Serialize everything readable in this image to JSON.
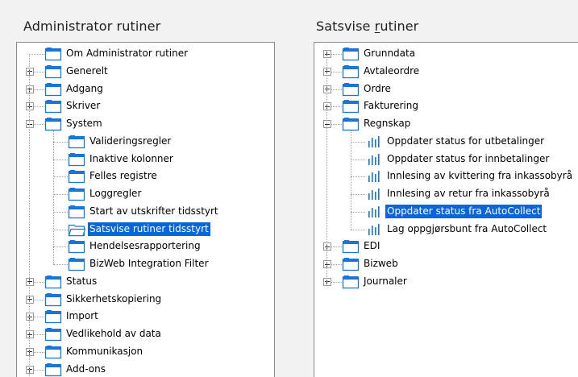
{
  "left_panel": {
    "title": "Administrator rutiner",
    "items": [
      {
        "label": "Om Administrator rutiner",
        "level": 0,
        "expander": "none"
      },
      {
        "label": "Generelt",
        "level": 0,
        "expander": "plus"
      },
      {
        "label": "Adgang",
        "level": 0,
        "expander": "plus"
      },
      {
        "label": "Skriver",
        "level": 0,
        "expander": "plus"
      },
      {
        "label": "System",
        "level": 0,
        "expander": "minus"
      },
      {
        "label": "Valideringsregler",
        "level": 1,
        "expander": "none"
      },
      {
        "label": "Inaktive kolonner",
        "level": 1,
        "expander": "none"
      },
      {
        "label": "Felles registre",
        "level": 1,
        "expander": "none"
      },
      {
        "label": "Loggregler",
        "level": 1,
        "expander": "none"
      },
      {
        "label": "Start av utskrifter tidsstyrt",
        "level": 1,
        "expander": "none"
      },
      {
        "label": "Satsvise rutiner tidsstyrt",
        "level": 1,
        "expander": "none",
        "selected": true,
        "open": true
      },
      {
        "label": "Hendelsesrapportering",
        "level": 1,
        "expander": "none"
      },
      {
        "label": "BizWeb Integration Filter",
        "level": 1,
        "expander": "none"
      },
      {
        "label": "Status",
        "level": 0,
        "expander": "plus"
      },
      {
        "label": "Sikkerhetskopiering",
        "level": 0,
        "expander": "plus"
      },
      {
        "label": "Import",
        "level": 0,
        "expander": "plus"
      },
      {
        "label": "Vedlikehold av data",
        "level": 0,
        "expander": "plus"
      },
      {
        "label": "Kommunikasjon",
        "level": 0,
        "expander": "plus"
      },
      {
        "label": "Add-ons",
        "level": 0,
        "expander": "plus"
      }
    ]
  },
  "right_panel": {
    "title_prefix": "Satsvise ",
    "title_accel": "r",
    "title_rest": "utiner",
    "items": [
      {
        "label": "Grunndata",
        "level": 0,
        "expander": "plus"
      },
      {
        "label": "Avtaleordre",
        "level": 0,
        "expander": "plus"
      },
      {
        "label": "Ordre",
        "level": 0,
        "expander": "plus"
      },
      {
        "label": "Fakturering",
        "level": 0,
        "expander": "plus"
      },
      {
        "label": "Regnskap",
        "level": 0,
        "expander": "minus"
      },
      {
        "label": "Oppdater status for utbetalinger",
        "level": 1,
        "kind": "chart"
      },
      {
        "label": "Oppdater status for innbetalinger",
        "level": 1,
        "kind": "chart"
      },
      {
        "label": "Innlesing av kvittering fra inkassobyrå",
        "level": 1,
        "kind": "chart"
      },
      {
        "label": "Innlesing av retur fra inkassobyrå",
        "level": 1,
        "kind": "chart"
      },
      {
        "label": "Oppdater status fra AutoCollect",
        "level": 1,
        "kind": "chart",
        "selected": true
      },
      {
        "label": "Lag oppgjørsbunt fra AutoCollect",
        "level": 1,
        "kind": "chart"
      },
      {
        "label": "EDI",
        "level": 0,
        "expander": "plus"
      },
      {
        "label": "Bizweb",
        "level": 0,
        "expander": "plus"
      },
      {
        "label": "Journaler",
        "level": 0,
        "expander": "plus"
      }
    ]
  },
  "colors": {
    "selection": "#0a66d8",
    "folder_top": "#1b75d6",
    "folder_body": "#ffffff",
    "tree_line": "#a0a0a0",
    "chart_icon": "#1b75d6"
  },
  "icons": {
    "folder": "folder-icon",
    "open_folder": "open-folder-icon",
    "report": "bar-chart-icon",
    "expand": "plus-expander-icon",
    "collapse": "minus-expander-icon"
  }
}
